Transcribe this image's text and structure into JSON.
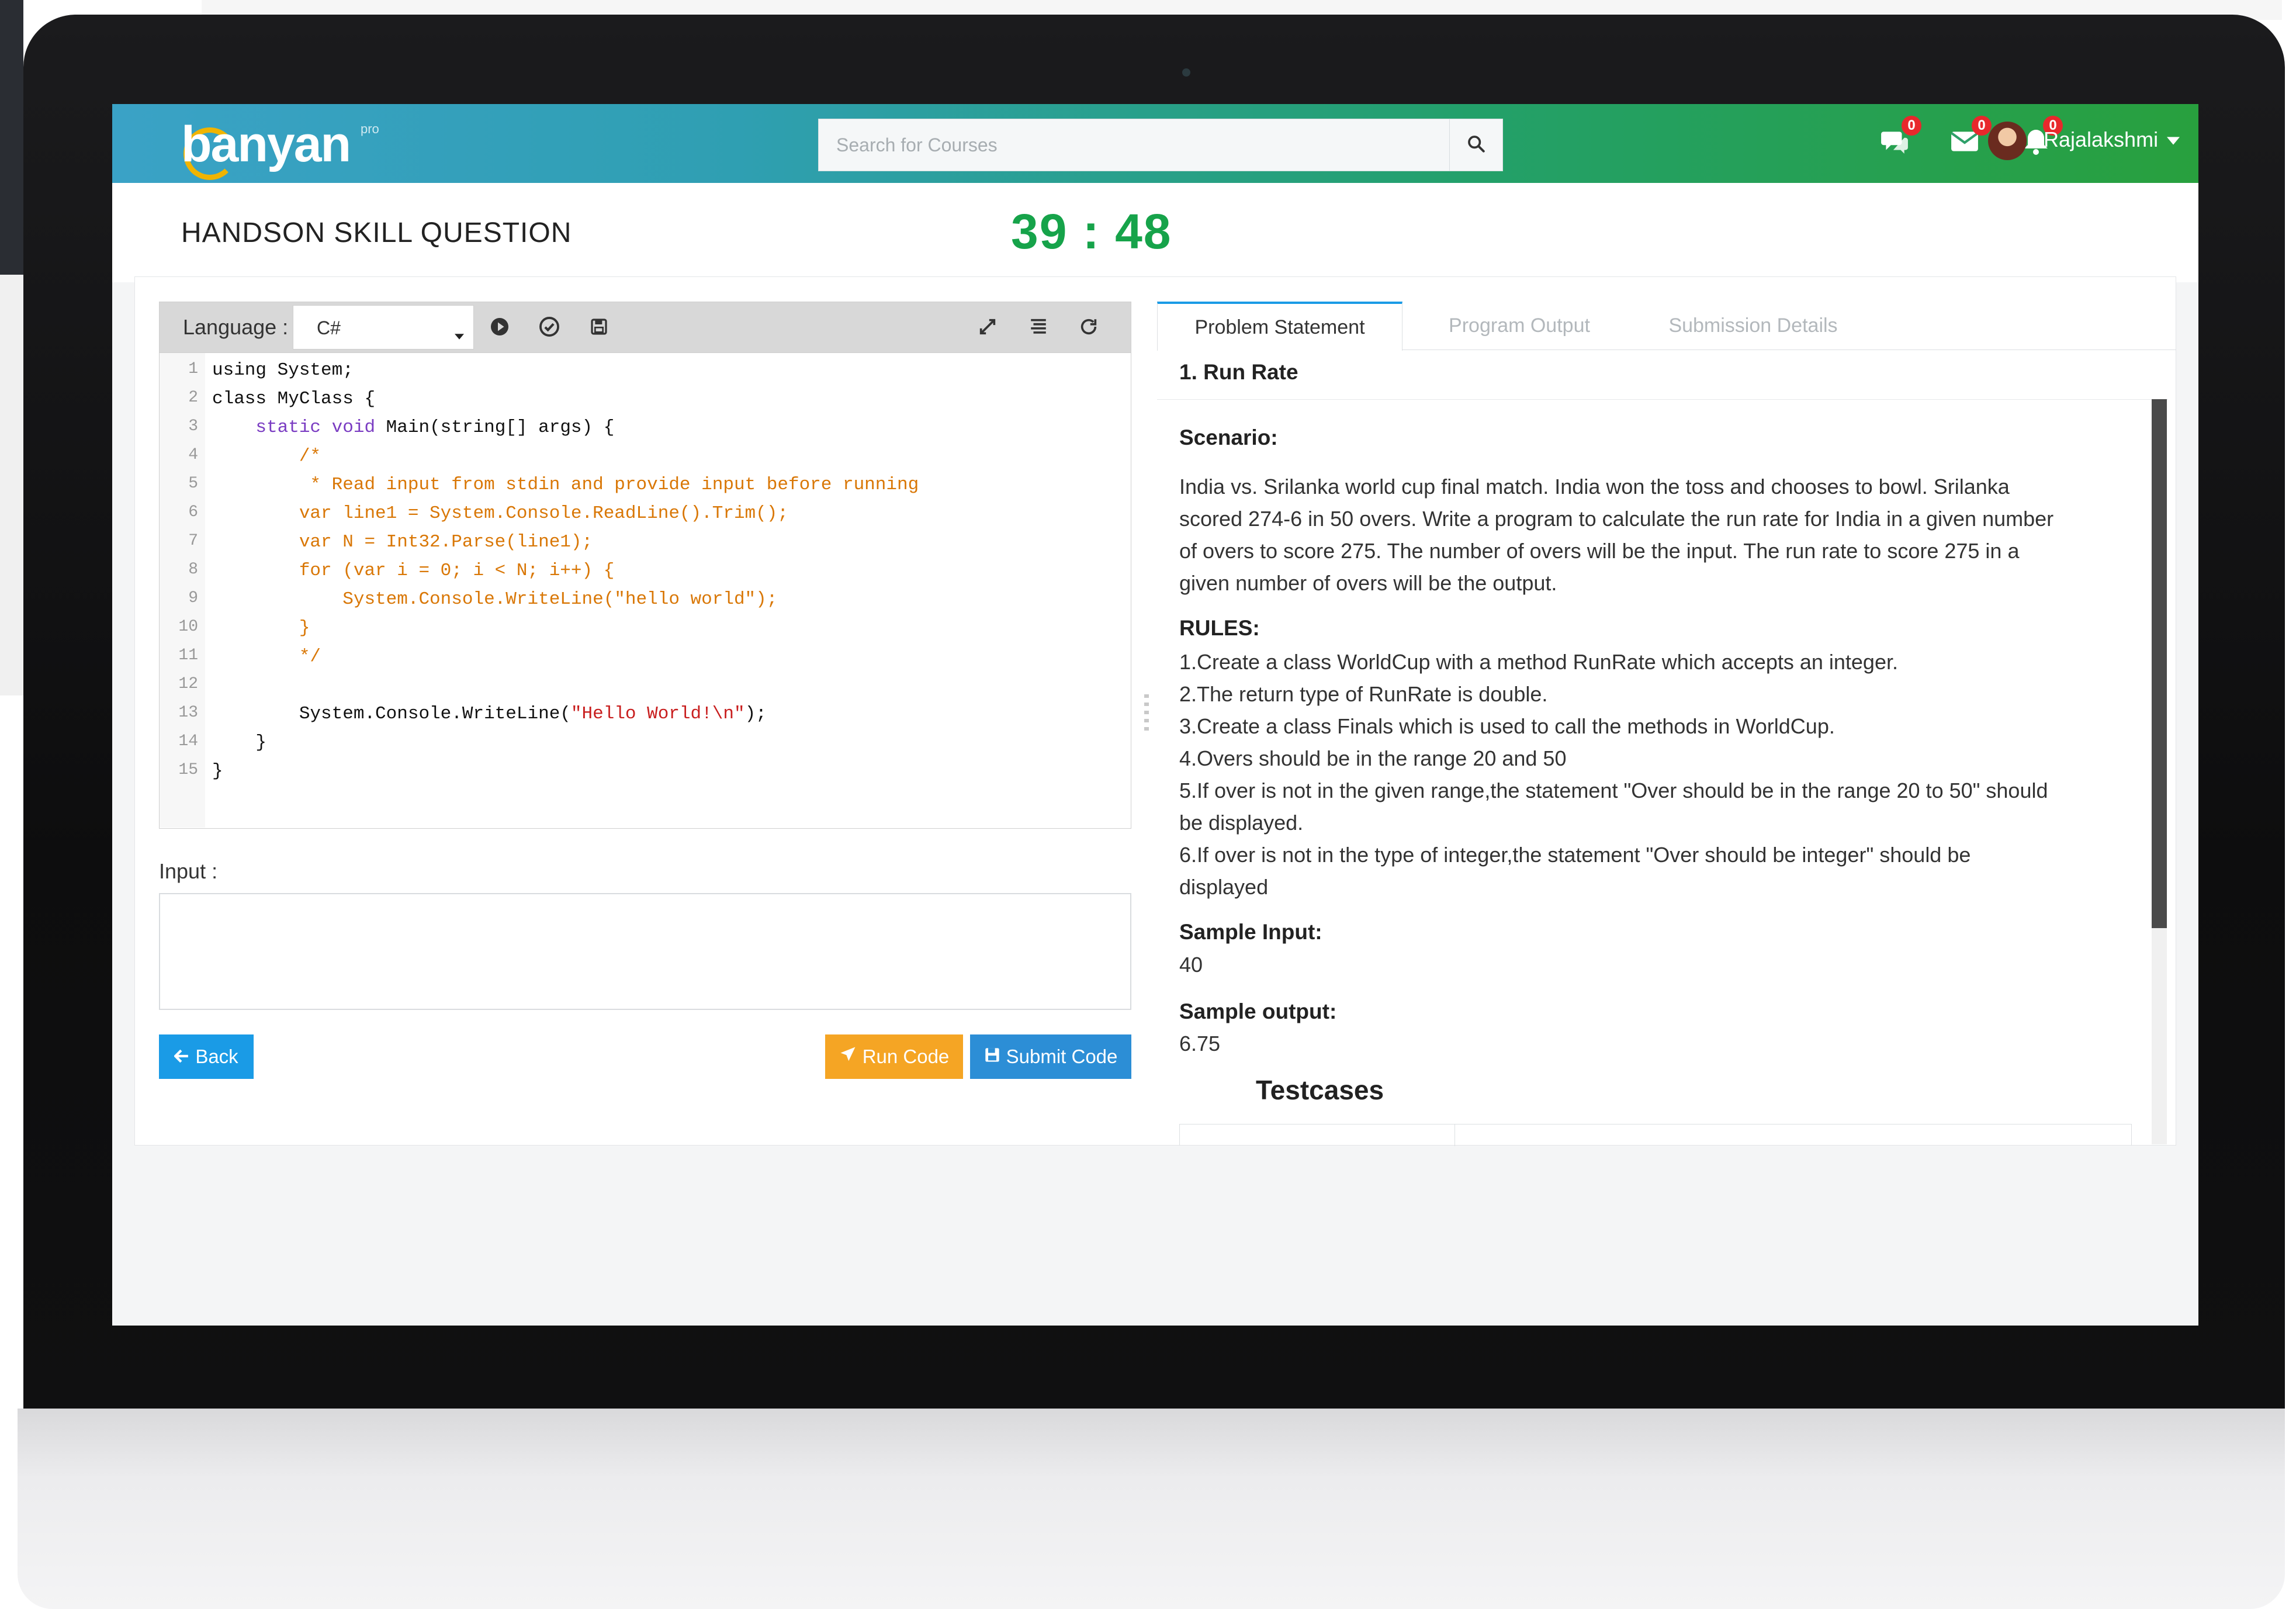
{
  "app": {
    "logo_text": "banyan",
    "logo_sup": "pro"
  },
  "header": {
    "search_placeholder": "Search for Courses",
    "chat_count": "0",
    "mail_count": "0",
    "bell_count": "0",
    "user_name": "Rajalakshmi"
  },
  "page": {
    "title": "HANDSON SKILL QUESTION",
    "timer": "39 : 48"
  },
  "editor": {
    "language_label": "Language :",
    "language_value": "C#",
    "lines": [
      {
        "n": "1",
        "parts": [
          {
            "t": "using System;",
            "c": ""
          }
        ]
      },
      {
        "n": "2",
        "parts": [
          {
            "t": "class MyClass {",
            "c": ""
          }
        ]
      },
      {
        "n": "3",
        "parts": [
          {
            "t": "    ",
            "c": ""
          },
          {
            "t": "static void",
            "c": "kw"
          },
          {
            "t": " Main(string[] args) {",
            "c": ""
          }
        ]
      },
      {
        "n": "4",
        "parts": [
          {
            "t": "        /*",
            "c": "cm"
          }
        ]
      },
      {
        "n": "5",
        "parts": [
          {
            "t": "         * Read input from stdin and provide input before running",
            "c": "cm"
          }
        ]
      },
      {
        "n": "6",
        "parts": [
          {
            "t": "        var line1 = System.Console.ReadLine().Trim();",
            "c": "cm"
          }
        ]
      },
      {
        "n": "7",
        "parts": [
          {
            "t": "        var N = Int32.Parse(line1);",
            "c": "cm"
          }
        ]
      },
      {
        "n": "8",
        "parts": [
          {
            "t": "        for (var i = 0; i < N; i++) {",
            "c": "cm"
          }
        ]
      },
      {
        "n": "9",
        "parts": [
          {
            "t": "            System.Console.WriteLine(\"hello world\");",
            "c": "cm"
          }
        ]
      },
      {
        "n": "10",
        "parts": [
          {
            "t": "        }",
            "c": "cm"
          }
        ]
      },
      {
        "n": "11",
        "parts": [
          {
            "t": "        */",
            "c": "cm"
          }
        ]
      },
      {
        "n": "12",
        "parts": [
          {
            "t": "",
            "c": ""
          }
        ]
      },
      {
        "n": "13",
        "parts": [
          {
            "t": "        System.Console.WriteLine(",
            "c": ""
          },
          {
            "t": "\"Hello World!\\n\"",
            "c": "str"
          },
          {
            "t": ");",
            "c": ""
          }
        ]
      },
      {
        "n": "14",
        "parts": [
          {
            "t": "    }",
            "c": ""
          }
        ]
      },
      {
        "n": "15",
        "parts": [
          {
            "t": "}",
            "c": ""
          }
        ]
      }
    ],
    "input_label": "Input :",
    "input_value": "",
    "back_label": "Back",
    "run_label": "Run Code",
    "submit_label": "Submit Code"
  },
  "tabs": [
    {
      "label": "Problem Statement",
      "active": true
    },
    {
      "label": "Program Output",
      "active": false
    },
    {
      "label": "Submission Details",
      "active": false
    }
  ],
  "problem": {
    "title": "1. Run Rate",
    "scenario_heading": "Scenario:",
    "scenario_lines": [
      "India vs. Srilanka world cup final match. India won the toss and chooses to bowl. Srilanka",
      "scored 274-6 in 50 overs. Write a program to calculate the run rate for India in a given number",
      "of overs to score 275. The number of overs will be the input. The run rate to score 275 in a",
      "given number of overs will be the output."
    ],
    "rules_heading": "RULES:",
    "rules_lines": [
      "1.Create a class WorldCup with a method RunRate which accepts an integer.",
      "2.The return type of RunRate is double.",
      "3.Create a class Finals which is used to call the methods in WorldCup.",
      "4.Overs should be in the range 20 and 50",
      "5.If over is not in the given range,the statement \"Over should be in the range 20 to 50\" should",
      "be displayed.",
      "6.If over is not in the type of integer,the statement \"Over should be integer\" should be",
      "displayed"
    ],
    "sample_input_heading": "Sample Input:",
    "sample_input": "40",
    "sample_output_heading": "Sample output:",
    "sample_output": "6.75",
    "testcases_heading": "Testcases"
  },
  "colors": {
    "timer": "#16a34a",
    "run_button": "#f5a524",
    "submit_button": "#2c8ed6",
    "back_button": "#1a9be6",
    "badge": "#e8282c"
  }
}
